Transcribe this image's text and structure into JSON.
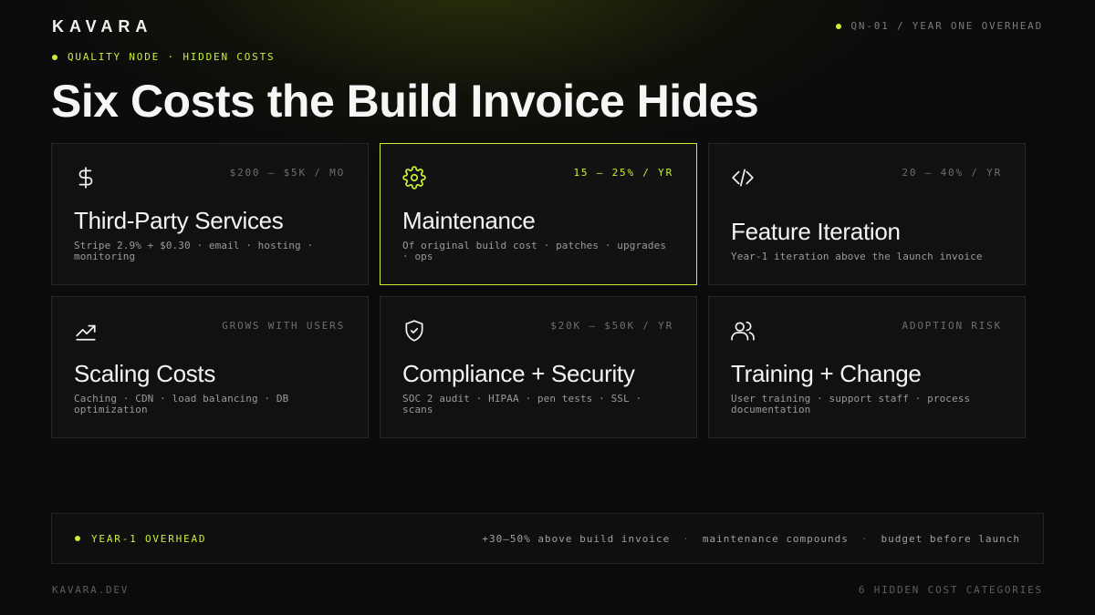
{
  "header": {
    "brand": "KAVARA",
    "meta": "QN-01 / YEAR ONE OVERHEAD",
    "kicker": "QUALITY NODE · HIDDEN COSTS",
    "title": "Six Costs the Build Invoice Hides"
  },
  "accent_color": "#c8f135",
  "cards": [
    {
      "icon": "dollar-icon",
      "tag": "$200 – $5K / MO",
      "title": "Third-Party Services",
      "desc": "Stripe 2.9% + $0.30 · email · hosting · monitoring",
      "highlighted": false
    },
    {
      "icon": "gear-icon",
      "tag": "15 – 25% / YR",
      "title": "Maintenance",
      "desc": "Of original build cost · patches · upgrades · ops",
      "highlighted": true
    },
    {
      "icon": "code-icon",
      "tag": "20 – 40% / YR",
      "title": "Feature Iteration",
      "desc": "Year-1 iteration above the launch invoice",
      "highlighted": false
    },
    {
      "icon": "trending-up-icon",
      "tag": "GROWS WITH USERS",
      "title": "Scaling Costs",
      "desc": "Caching · CDN · load balancing · DB optimization",
      "highlighted": false
    },
    {
      "icon": "shield-check-icon",
      "tag": "$20K – $50K / YR",
      "title": "Compliance + Security",
      "desc": "SOC 2 audit · HIPAA · pen tests · SSL · scans",
      "highlighted": false
    },
    {
      "icon": "users-icon",
      "tag": "ADOPTION RISK",
      "title": "Training + Change",
      "desc": "User training · support staff · process documentation",
      "highlighted": false
    }
  ],
  "summary": {
    "label": "YEAR-1 OVERHEAD",
    "points": [
      "+30–50% above build invoice",
      "maintenance compounds",
      "budget before launch"
    ],
    "separator": "·"
  },
  "footer": {
    "left": "KAVARA.DEV",
    "right": "6 HIDDEN COST CATEGORIES"
  }
}
